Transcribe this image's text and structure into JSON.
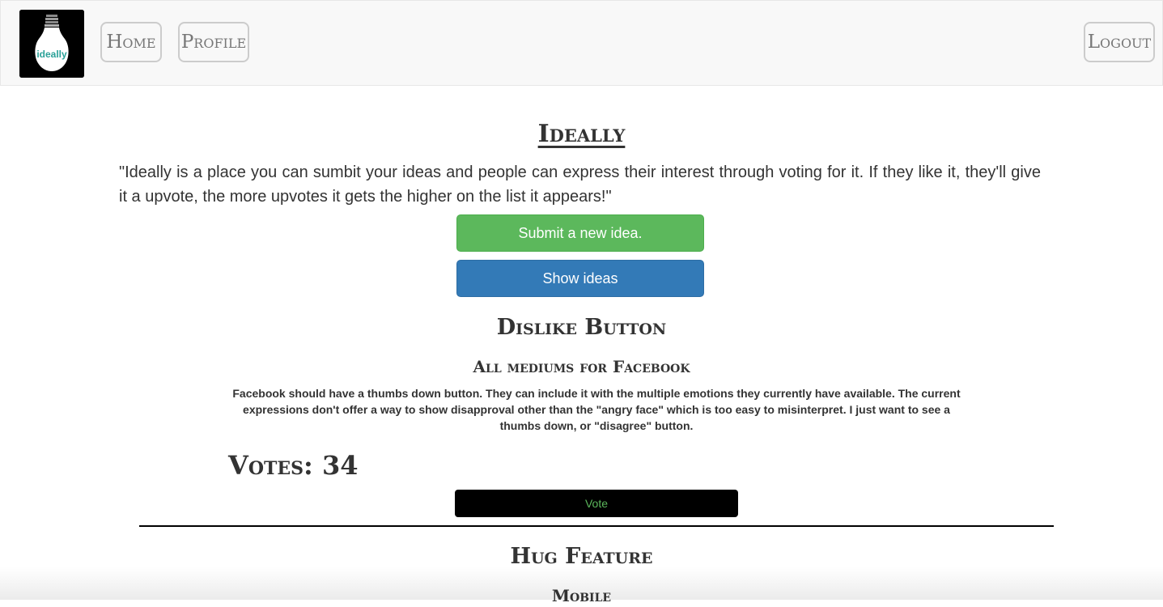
{
  "nav": {
    "logo_text": "ideally",
    "home_label": "Home",
    "profile_label": "Profile",
    "logout_label": "Logout"
  },
  "main": {
    "title": "Ideally",
    "intro": "\"Ideally is a place you can sumbit your ideas and people can express their interest through voting for it. If they like it, they'll give it a upvote, the more upvotes it gets the higher on the list it appears!\"",
    "submit_label": "Submit a new idea.",
    "show_label": "Show ideas"
  },
  "ideas": [
    {
      "title": "Dislike Button",
      "category": "All mediums for Facebook",
      "description": "Facebook should have a thumbs down button. They can include it with the multiple emotions they currently have available. The current expressions don't offer a way to show disapproval other than the \"angry face\" which is too easy to misinterpret. I just want to see a thumbs down, or \"disagree\" button.",
      "votes_label": "Votes: 34",
      "vote_button": "Vote"
    },
    {
      "title": "Hug Feature",
      "category": "Mobile"
    }
  ],
  "colors": {
    "success": "#5cb85c",
    "primary": "#337ab7",
    "navbar_bg": "#f8f8f8",
    "logo_accent": "#2aa198"
  },
  "icons": {
    "logo": "lightbulb-icon"
  }
}
